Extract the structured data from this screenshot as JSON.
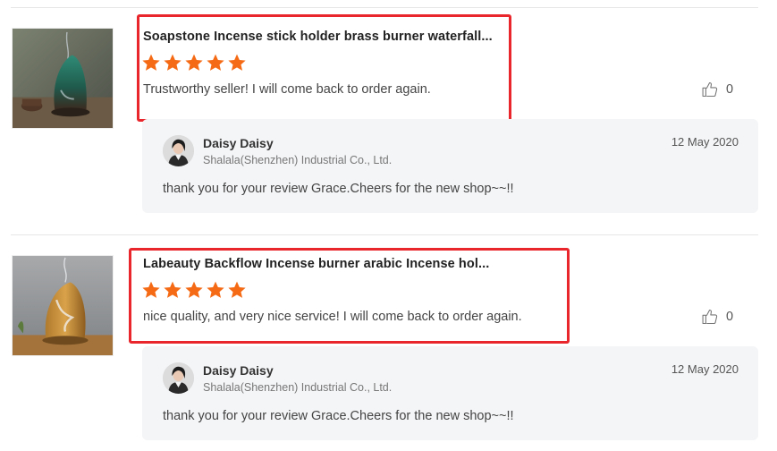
{
  "reviews": [
    {
      "product_title": "Soapstone Incense stick holder brass burner waterfall...",
      "rating": 5,
      "comment": "Trustworthy seller!  I will come back to order again.",
      "likes": "0",
      "reply": {
        "name": "Daisy Daisy",
        "company": "Shalala(Shenzhen) Industrial Co., Ltd.",
        "date": "12 May 2020",
        "text": "thank you for your review Grace.Cheers for the new shop~~!!"
      }
    },
    {
      "product_title": "Labeauty Backflow Incense burner arabic Incense hol...",
      "rating": 5,
      "comment": "nice quality, and very nice service! I will come back to order again.",
      "likes": "0",
      "reply": {
        "name": "Daisy Daisy",
        "company": "Shalala(Shenzhen) Industrial Co., Ltd.",
        "date": "12 May 2020",
        "text": "thank you for your review Grace.Cheers for the new shop~~!!"
      }
    }
  ],
  "colors": {
    "star": "#f56a14",
    "highlight_border": "#e8262b",
    "reply_bg": "#f4f5f7"
  },
  "icons": {
    "like": "thumbs-up-icon",
    "star": "star-icon"
  }
}
